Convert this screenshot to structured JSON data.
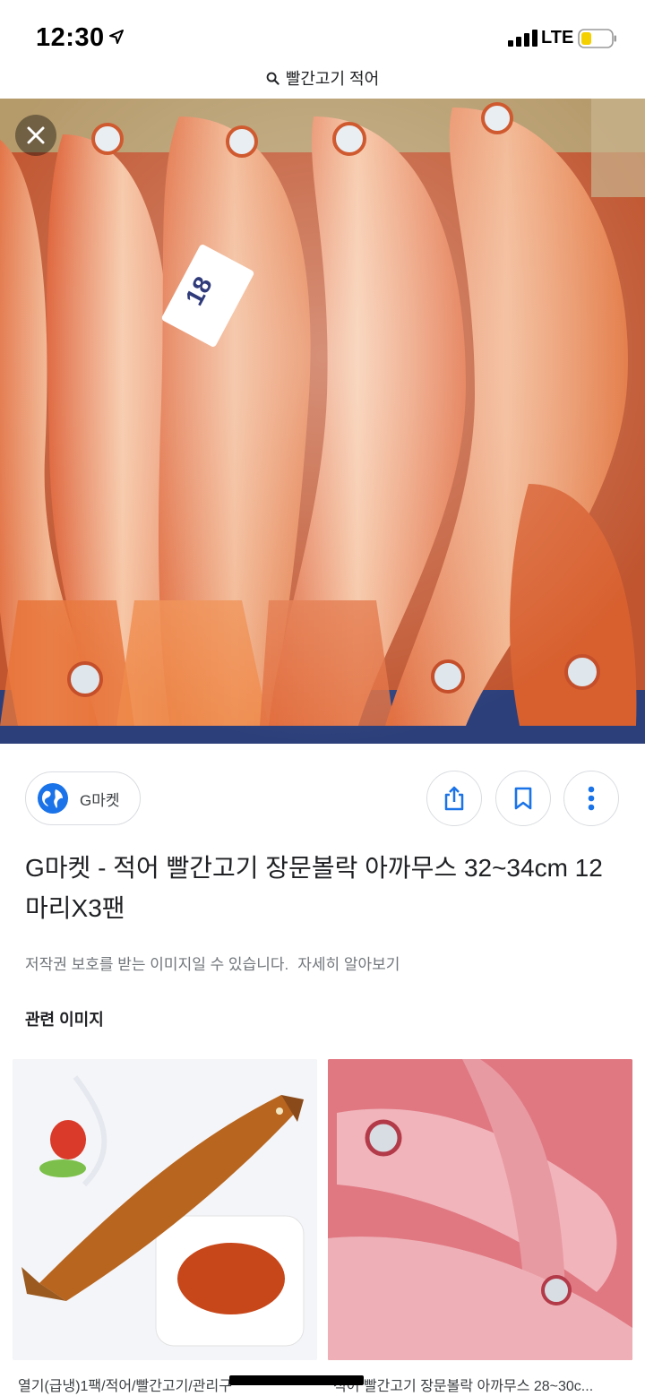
{
  "status_bar": {
    "time": "12:30",
    "network": "LTE"
  },
  "url_bar": {
    "text": "빨간고기 적어"
  },
  "source": {
    "name": "G마켓"
  },
  "title": "G마켓 - 적어 빨간고기 장문볼락 아까무스 32~34cm 12마리X3팬",
  "copyright": {
    "notice": "저작권 보호를 받는 이미지일 수 있습니다.",
    "learn_more": "자세히 알아보기"
  },
  "related": {
    "heading": "관련 이미지",
    "items": [
      {
        "caption": "열기(급냉)1팩/적어/빨간고기/관리구"
      },
      {
        "caption": "적어 빨간고기 장문볼락 아까무스 28~30c..."
      }
    ]
  },
  "icons": {
    "location": "location-arrow-icon",
    "search": "search-icon",
    "close": "close-icon",
    "globe": "globe-icon",
    "share": "share-icon",
    "save": "bookmark-icon",
    "more": "more-vertical-icon"
  },
  "colors": {
    "accent": "#1a73e8",
    "battery": "#f5d000"
  }
}
